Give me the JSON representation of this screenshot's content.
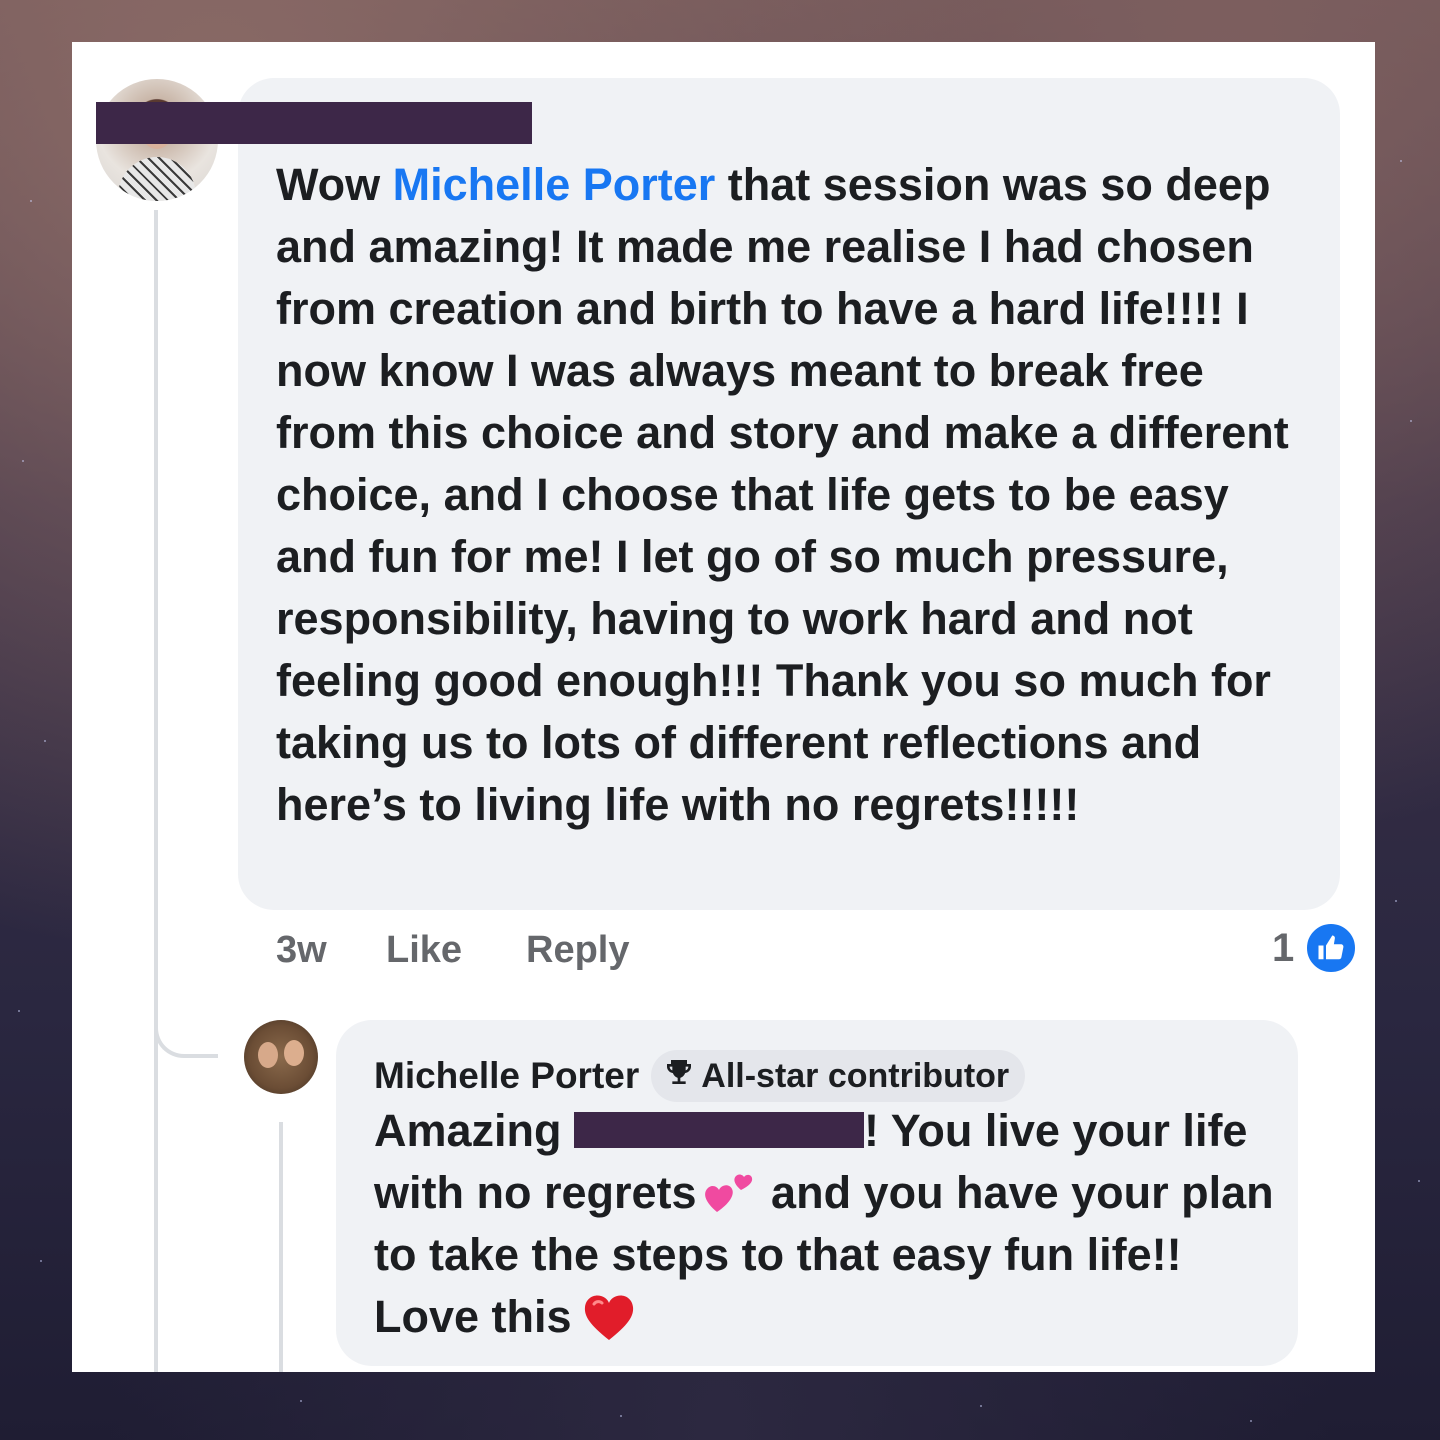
{
  "comment": {
    "mention": "Michelle Porter",
    "text_before": "Wow ",
    "text_after": " that session was so deep and amazing! It made me realise I had chosen from creation and birth to have a hard life!!!! I now know I was always meant to break free from this choice and story and make a different choice, and I choose that life gets to be easy and fun for me! I let go of so much pressure, responsibility, having to work hard and not feeling good enough!!! Thank you so much for taking us to lots of different reflections and here’s to living life with no regrets!!!!!",
    "time": "3w",
    "like_label": "Like",
    "reply_label": "Reply",
    "like_count": "1"
  },
  "reply": {
    "author": "Michelle Porter",
    "badge": "All-star contributor",
    "text_part1": "Amazing ",
    "text_part2": "! You live your life with no regrets",
    "text_part3": " and you have your plan to take the steps to that easy fun life!! Love this"
  },
  "icons": {
    "trophy": "trophy-icon",
    "thumbs_up": "thumbs-up-icon",
    "two_hearts": "two-hearts-emoji",
    "red_heart": "red-heart-emoji"
  },
  "colors": {
    "mention": "#1877f2",
    "bubble": "#f0f2f5",
    "redaction": "#3d2748",
    "meta_text": "#65676b"
  }
}
